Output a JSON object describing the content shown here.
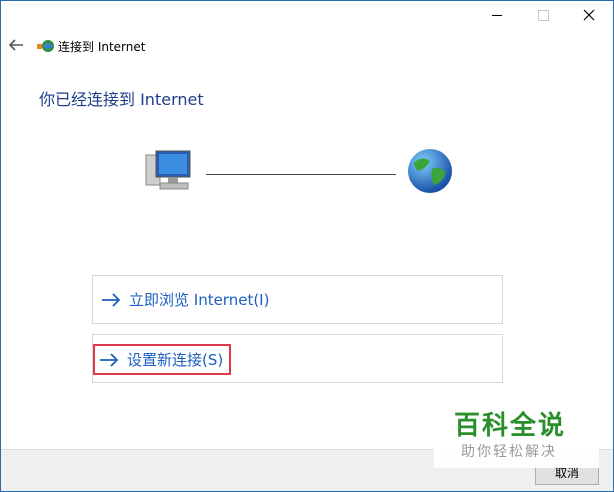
{
  "window": {
    "title": "连接到 Internet",
    "controls": {
      "minimize": "minimize",
      "maximize": "maximize",
      "close": "close"
    }
  },
  "main": {
    "heading": "你已经连接到 Internet",
    "diagram": {
      "computer_icon": "computer-icon",
      "globe_icon": "globe-icon"
    },
    "options": [
      {
        "label": "立即浏览 Internet(I)",
        "icon": "arrow-right-icon"
      },
      {
        "label": "设置新连接(S)",
        "icon": "arrow-right-icon",
        "highlighted": true
      }
    ]
  },
  "footer": {
    "cancel_label": "取消"
  },
  "watermark": {
    "title": "百科全说",
    "subtitle": "助你轻松解决"
  },
  "colors": {
    "heading": "#1e3d8c",
    "link": "#1b5fbf",
    "highlight": "#e03a4a",
    "watermark": "#2a8f2a"
  }
}
